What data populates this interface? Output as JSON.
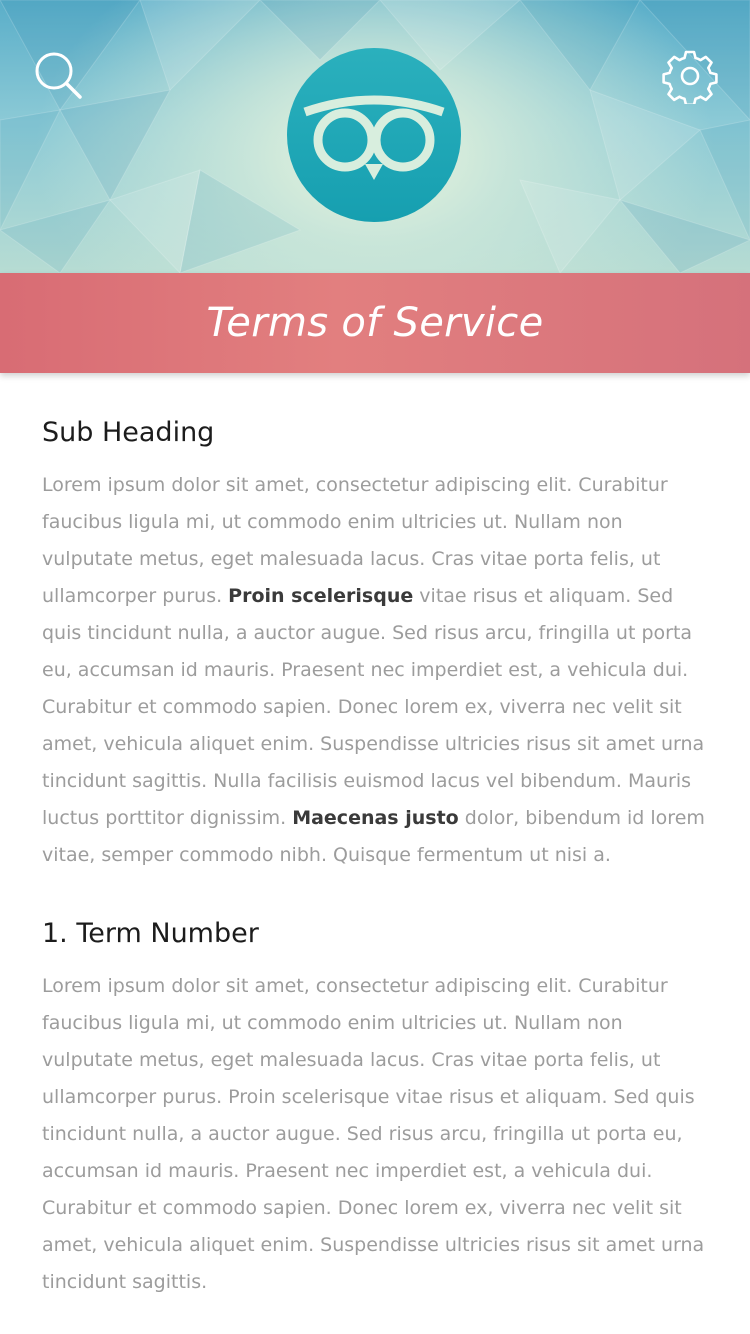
{
  "header": {
    "search_icon": "search-icon",
    "settings_icon": "gear-icon",
    "logo_icon": "owl-logo-icon",
    "colors": {
      "sky_top": "#5aaec9",
      "logo_teal": "#29aab9",
      "band": "#e27f7f"
    }
  },
  "title": "Terms of Service",
  "section1": {
    "heading": "Sub Heading",
    "para_a": "Lorem ipsum dolor sit amet, consectetur adipiscing elit. Curabitur faucibus ligula mi, ut commodo enim ultricies ut. Nullam non vulputate metus, eget malesuada lacus. Cras vitae porta felis, ut ullamcorper purus. ",
    "bold_a": "Proin scelerisque",
    "para_b": " vitae risus et aliquam. Sed quis tincidunt nulla, a auctor augue. Sed risus arcu, fringilla ut porta eu, accumsan id mauris. Praesent nec imperdiet est, a vehicula dui. Curabitur et commodo sapien. Donec lorem ex, viverra nec velit sit amet, vehicula aliquet enim. Suspendisse ultricies risus sit amet urna tincidunt sagittis. Nulla facilisis euismod lacus vel bibendum. Mauris luctus porttitor dignissim. ",
    "bold_b": "Maecenas justo",
    "para_c": " dolor, bibendum id lorem vitae, semper commodo nibh. Quisque fermentum ut nisi a."
  },
  "section2": {
    "heading": "1. Term Number",
    "paragraph": "Lorem ipsum dolor sit amet, consectetur adipiscing elit. Curabitur faucibus ligula mi, ut commodo enim ultricies ut. Nullam non vulputate metus, eget malesuada lacus. Cras vitae porta felis, ut ullamcorper purus. Proin scelerisque vitae risus et aliquam. Sed quis tincidunt nulla, a auctor augue. Sed risus arcu, fringilla ut porta eu, accumsan id mauris. Praesent nec imperdiet est, a vehicula dui. Curabitur et commodo sapien. Donec lorem ex, viverra nec velit sit amet, vehicula aliquet enim. Suspendisse ultricies risus sit amet urna tincidunt sagittis."
  }
}
